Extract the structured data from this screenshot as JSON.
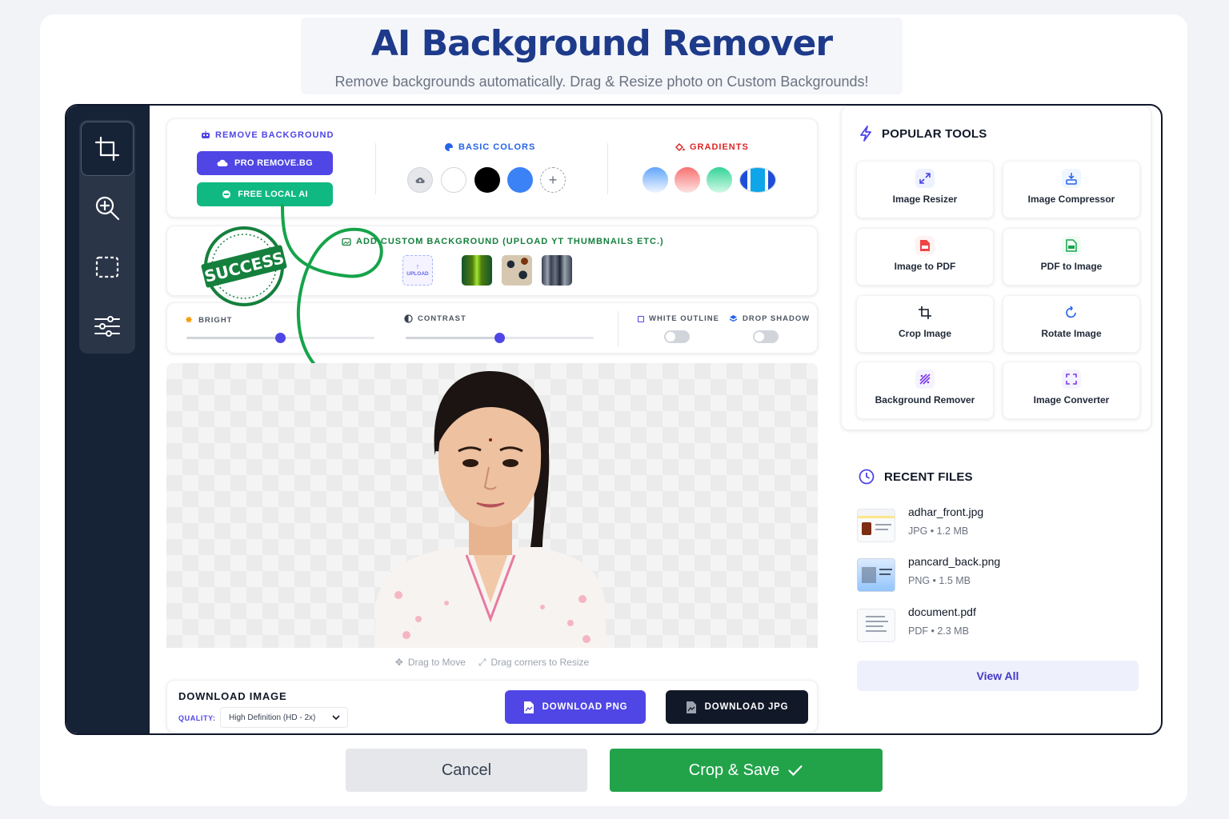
{
  "header": {
    "title": "AI Background Remover",
    "subtitle": "Remove backgrounds automatically. Drag & Resize photo on Custom Backgrounds!"
  },
  "sidebar": {
    "tools": [
      {
        "icon": "crop-icon",
        "active": true
      },
      {
        "icon": "zoom-in-icon",
        "active": false
      },
      {
        "icon": "marquee-select-icon",
        "active": false
      },
      {
        "icon": "sliders-icon",
        "active": false
      }
    ]
  },
  "remove_bg": {
    "label": "REMOVE BACKGROUND",
    "pro_button": "PRO REMOVE.BG",
    "local_button": "FREE LOCAL AI"
  },
  "basic_colors": {
    "label": "BASIC COLORS",
    "swatches": [
      "transparent",
      "#ffffff",
      "#000000",
      "#3b82f6",
      "custom"
    ]
  },
  "gradients": {
    "label": "GRADIENTS",
    "swatches": [
      "blue",
      "red",
      "green",
      "striped-blue"
    ]
  },
  "custom_bg": {
    "label": "ADD CUSTOM BACKGROUND (UPLOAD YT THUMBNAILS ETC.)",
    "upload_label": "UPLOAD",
    "stamp_text": "SUCCESS"
  },
  "adjustments": {
    "bright_label": "BRIGHT",
    "bright_value": 0.5,
    "contrast_label": "CONTRAST",
    "contrast_value": 0.5,
    "white_outline_label": "WHITE OUTLINE",
    "white_outline_on": false,
    "drop_shadow_label": "DROP SHADOW",
    "drop_shadow_on": false
  },
  "canvas": {
    "hint_move": "Drag to Move",
    "hint_resize": "Drag corners to Resize"
  },
  "download": {
    "title": "DOWNLOAD IMAGE",
    "quality_label": "QUALITY:",
    "quality_value": "High Definition (HD - 2x)",
    "png_button": "DOWNLOAD PNG",
    "jpg_button": "DOWNLOAD JPG"
  },
  "popular_tools": {
    "title": "POPULAR TOOLS",
    "items": [
      {
        "label": "Image Resizer",
        "icon": "expand-arrows-icon"
      },
      {
        "label": "Image Compressor",
        "icon": "compress-icon"
      },
      {
        "label": "Image to PDF",
        "icon": "pdf-file-icon"
      },
      {
        "label": "PDF to Image",
        "icon": "image-file-icon"
      },
      {
        "label": "Crop Image",
        "icon": "crop-icon"
      },
      {
        "label": "Rotate Image",
        "icon": "rotate-icon"
      },
      {
        "label": "Background Remover",
        "icon": "magic-wand-icon"
      },
      {
        "label": "Image Converter",
        "icon": "convert-icon"
      }
    ]
  },
  "recent_files": {
    "title": "RECENT FILES",
    "items": [
      {
        "name": "adhar_front.jpg",
        "meta": "JPG • 1.2 MB"
      },
      {
        "name": "pancard_back.png",
        "meta": "PNG • 1.5 MB"
      },
      {
        "name": "document.pdf",
        "meta": "PDF • 2.3 MB"
      }
    ],
    "view_all": "View All"
  },
  "footer": {
    "cancel": "Cancel",
    "save": "Crop & Save"
  },
  "colors": {
    "accent": "#4f46e5",
    "success": "#16a34a",
    "teal": "#10b981",
    "dark": "#162236",
    "title": "#1e3a8a"
  }
}
